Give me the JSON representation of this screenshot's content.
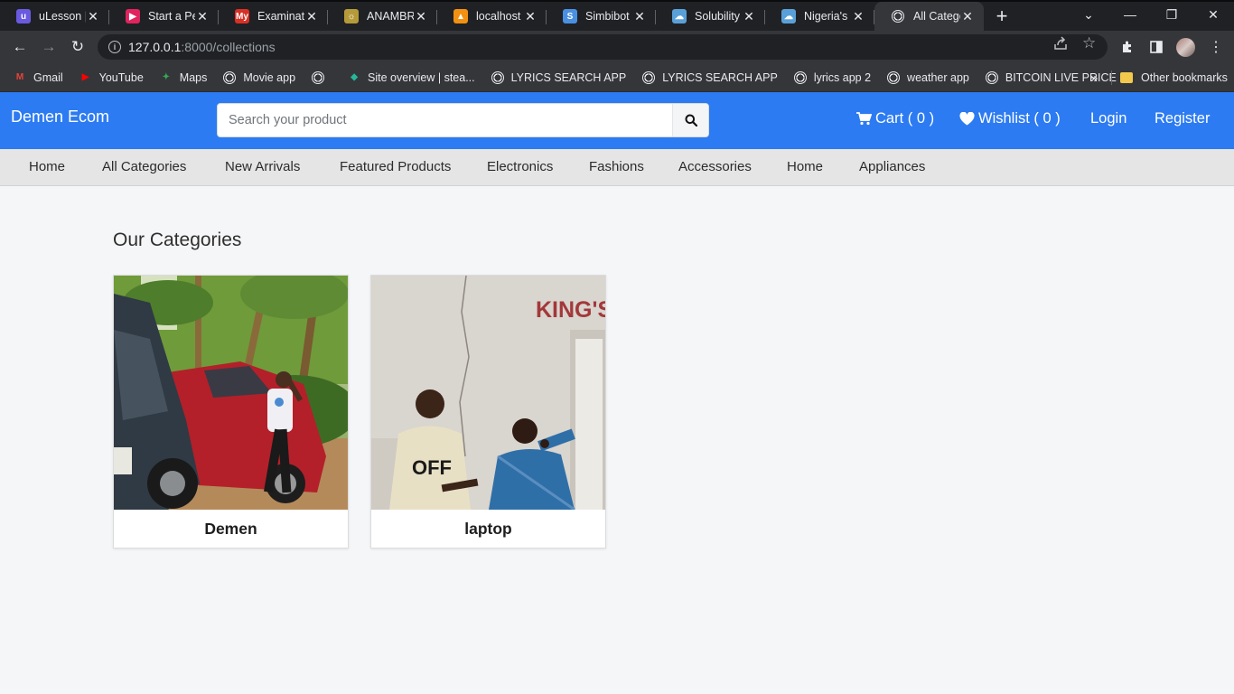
{
  "browser": {
    "tabs": [
      {
        "title": "uLesson | #",
        "favicon_color": "#6a5ae0",
        "favicon_glyph": "u",
        "active": false
      },
      {
        "title": "Start a Pers",
        "favicon_color": "#e0245e",
        "favicon_glyph": "▶",
        "active": false
      },
      {
        "title": "Examinatio",
        "favicon_color": "#d93025",
        "favicon_glyph": "My",
        "active": false
      },
      {
        "title": "ANAMBRA",
        "favicon_color": "#b59a3a",
        "favicon_glyph": "☼",
        "active": false
      },
      {
        "title": "localhost /",
        "favicon_color": "#f29111",
        "favicon_glyph": "▲",
        "active": false
      },
      {
        "title": "Simbibot -",
        "favicon_color": "#4a90e2",
        "favicon_glyph": "S",
        "active": false
      },
      {
        "title": "Solubility v",
        "favicon_color": "#5aa0d8",
        "favicon_glyph": "☁",
        "active": false
      },
      {
        "title": "Nigeria's M",
        "favicon_color": "#5aa0d8",
        "favicon_glyph": "☁",
        "active": false
      },
      {
        "title": "All Catego",
        "favicon_color": "#e8eaed",
        "favicon_glyph": "",
        "active": true
      }
    ],
    "new_tab_glyph": "+",
    "window_controls": {
      "menu": "⌄",
      "minimize": "—",
      "restore": "❐",
      "close": "✕"
    },
    "nav": {
      "back": "←",
      "forward": "→",
      "reload": "↻"
    },
    "url_host": "127.0.0.1",
    "url_path": ":8000/collections",
    "bookmarks": [
      {
        "label": "Gmail",
        "icon": "gmail-icon",
        "color": "#ea4335",
        "glyph": "M"
      },
      {
        "label": "YouTube",
        "icon": "youtube-icon",
        "color": "#ff0000",
        "glyph": "▶"
      },
      {
        "label": "Maps",
        "icon": "maps-icon",
        "color": "#34a853",
        "glyph": "✦"
      },
      {
        "label": "Movie app",
        "icon": "globe-icon",
        "color": "",
        "glyph": ""
      },
      {
        "label": "",
        "icon": "globe-icon",
        "color": "",
        "glyph": ""
      },
      {
        "label": "Site overview | stea...",
        "icon": "diamond-icon",
        "color": "#25b79a",
        "glyph": "◆"
      },
      {
        "label": "LYRICS SEARCH APP",
        "icon": "globe-icon",
        "color": "",
        "glyph": ""
      },
      {
        "label": "LYRICS SEARCH APP",
        "icon": "globe-icon",
        "color": "",
        "glyph": ""
      },
      {
        "label": "lyrics app 2",
        "icon": "globe-icon",
        "color": "",
        "glyph": ""
      },
      {
        "label": "weather app",
        "icon": "globe-icon",
        "color": "",
        "glyph": ""
      },
      {
        "label": "BITCOIN LIVE PRICE",
        "icon": "globe-icon",
        "color": "",
        "glyph": ""
      }
    ],
    "bookmarks_overflow": "»",
    "other_bookmarks": "Other bookmarks"
  },
  "site": {
    "brand": "Demen Ecom",
    "search_placeholder": "Search your product",
    "cart_label": "Cart ( 0 )",
    "wishlist_label": "Wishlist ( 0 )",
    "login_label": "Login",
    "register_label": "Register",
    "accent_color": "#2c7bf2",
    "categories_nav": [
      "Home",
      "All Categories",
      "New Arrivals",
      "Featured Products",
      "Electronics",
      "Fashions",
      "Accessories",
      "Home",
      "Appliances"
    ]
  },
  "main": {
    "heading": "Our Categories",
    "cards": [
      {
        "name": "Demen"
      },
      {
        "name": "laptop",
        "wall_sign": "KING'S",
        "shirt_text": "OFF"
      }
    ]
  }
}
